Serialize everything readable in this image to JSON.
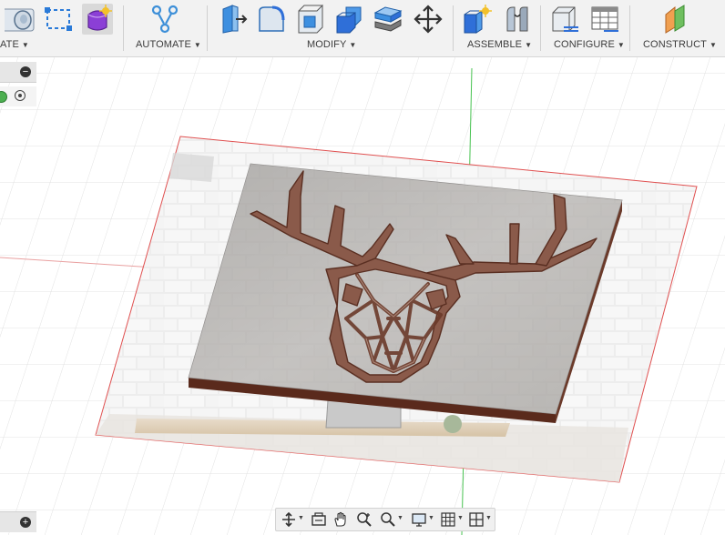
{
  "toolbar": {
    "groups": [
      {
        "label": "ATE",
        "caret": "▼"
      },
      {
        "label": "AUTOMATE",
        "caret": "▼"
      },
      {
        "label": "MODIFY",
        "caret": "▼"
      },
      {
        "label": "ASSEMBLE",
        "caret": "▼"
      },
      {
        "label": "CONFIGURE",
        "caret": "▼"
      },
      {
        "label": "CONSTRUCT",
        "caret": "▼"
      }
    ],
    "icons": {
      "create": [
        "cylinder-icon",
        "sketch-rectangle-icon",
        "form-icon"
      ],
      "automate": [
        "automate-icon"
      ],
      "modify": [
        "press-pull-icon",
        "fillet-icon",
        "shell-icon",
        "combine-icon",
        "split-body-icon",
        "move-icon"
      ],
      "assemble": [
        "new-component-icon",
        "joint-icon"
      ],
      "configure": [
        "configure-icon",
        "table-icon"
      ],
      "construct": [
        "offset-plane-icon"
      ]
    }
  },
  "browser": {
    "collapse_symbol": "−",
    "expand_symbol": "+"
  },
  "navigation_bar": {
    "icons": [
      "orbit-icon",
      "look-at-icon",
      "pan-icon",
      "zoom-icon",
      "fit-icon",
      "display-settings-icon",
      "grid-settings-icon",
      "viewports-icon"
    ]
  },
  "colors": {
    "accent_purple": "#8b3fd6",
    "accent_blue": "#2f6fd8",
    "deer_wood": "#8a5a4a",
    "board_gray": "#a9a6a3",
    "canvas_outline": "#e05050",
    "axis_green": "#46c24f"
  }
}
